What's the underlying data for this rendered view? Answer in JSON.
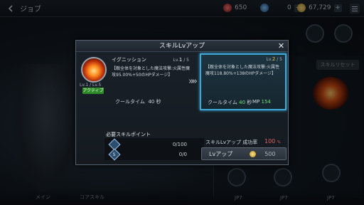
{
  "topbar": {
    "title": "ジョブ",
    "currency_red": "650",
    "currency_blue": "0",
    "currency_gold": "67,729",
    "plus": "+"
  },
  "background": {
    "reset_label": "スキルリセット",
    "tabs": [
      "メイン",
      "コアスキル",
      "JP7",
      "JP7",
      "JP7"
    ]
  },
  "modal": {
    "title": "スキルLvアップ",
    "close": "✕",
    "current": {
      "name": "イグニッション",
      "lv_prefix": "Lv.",
      "lv": "1",
      "lv_max": " / 5",
      "description": "【敵全体を対象とした魔法攻撃:火属性魔攻95.00%+50のHPダメージ】",
      "cooltime_label": "クールタイム",
      "cooltime_value": "40 秒",
      "small_level": "Lv.1 / Lv.5",
      "badge": "アクティブ"
    },
    "arrow": "»»",
    "next": {
      "lv_prefix": "Lv.",
      "lv": "2",
      "lv_max": " / 5",
      "description": "【敵全体を対象とした魔法攻撃:火属性魔攻118.80%+138のHPダメージ】",
      "cooltime_label": "クールタイム",
      "cooltime_value": "40",
      "cooltime_unit": "秒",
      "mp_label": "MP",
      "mp_value": "154"
    },
    "required": {
      "header": "必要スキルポイント",
      "rows": [
        {
          "icon": "",
          "value": "0/100"
        },
        {
          "icon": "S",
          "value": "0/0"
        }
      ]
    },
    "success_rate_label": "スキルLvアップ 成功率",
    "success_rate_value": "100",
    "success_rate_unit": "%",
    "levelup_button": "Lvアップ",
    "levelup_cost": "500"
  },
  "colors": {
    "accent_blue": "#3fa7d6",
    "active_green": "#2f8a2a",
    "rate_red": "#e26161",
    "next_level": "#f0c24a"
  }
}
